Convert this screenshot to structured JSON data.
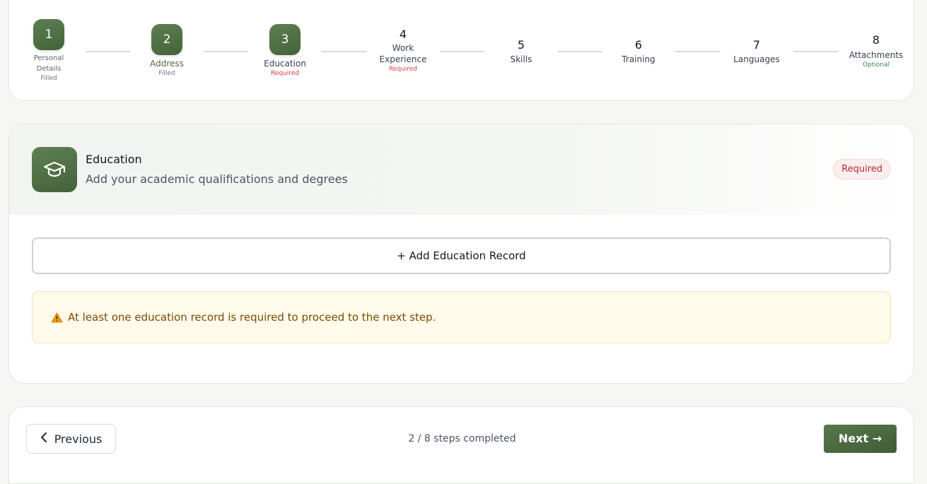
{
  "stepper": {
    "steps": [
      {
        "number": "1",
        "title_lines": [
          "Personal",
          "Details"
        ],
        "status": "Filled"
      },
      {
        "number": "2",
        "title": "Address",
        "status": "Filled"
      },
      {
        "number": "3",
        "title": "Education",
        "status": "Required"
      },
      {
        "number": "4",
        "title_lines": [
          "Work",
          "Experience"
        ],
        "status": "Required"
      },
      {
        "number": "5",
        "title": "Skills"
      },
      {
        "number": "6",
        "title": "Training"
      },
      {
        "number": "7",
        "title": "Languages"
      },
      {
        "number": "8",
        "title": "Attachments",
        "status": "Optional"
      }
    ]
  },
  "section": {
    "icon": "graduation-cap-icon",
    "title": "Education",
    "subtitle": "Add your academic qualifications and degrees",
    "badge": "Required",
    "add_button_label": "+ Add Education Record",
    "warning_icon": "warning-icon",
    "warning_text": "At least one education record is required to proceed to the next step."
  },
  "footer": {
    "previous_label": "Previous",
    "progress_text": "2 / 8 steps completed",
    "next_label": "Next →"
  },
  "colors": {
    "brand_green": "#4f6f45",
    "required_red": "#d1414b",
    "optional_green": "#2f8a4c",
    "warning_bg": "#fffbeb",
    "warning_text": "#7c4a03"
  }
}
